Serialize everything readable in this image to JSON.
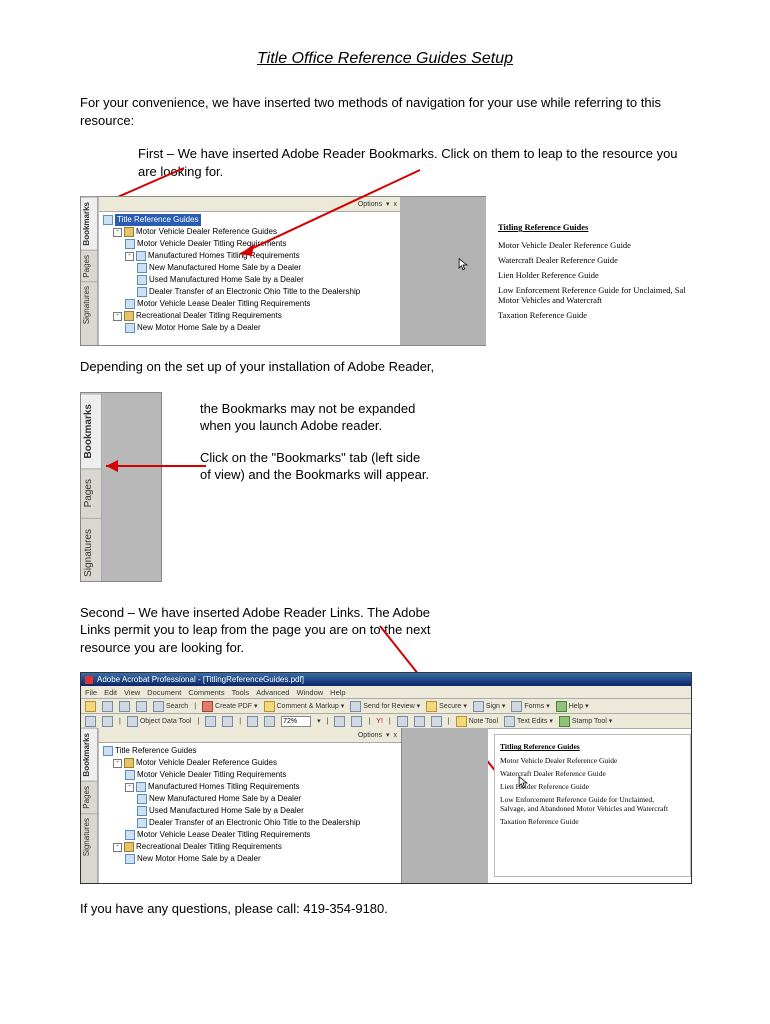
{
  "title": "Title Office Reference Guides Setup",
  "intro": "For your convenience, we have inserted two methods of navigation for your use while referring to this resource:",
  "first": "First – We have inserted Adobe Reader Bookmarks.  Click on them to leap to the resource you are looking for.",
  "depending": "Depending on the set up of your installation of Adobe Reader,",
  "second": "Second – We have inserted Adobe Reader Links. The Adobe Links permit you to leap from the page you are on to the next resource you are looking for.",
  "call": "If you have any questions, please call: 419-354-9180.",
  "shot2_a": "the Bookmarks may not be expanded when you launch Adobe reader.",
  "shot2_b": "Click on the \"Bookmarks\" tab (left side of view) and the Bookmarks will appear.",
  "tabs": {
    "bookmarks": "Bookmarks",
    "pages": "Pages",
    "signatures": "Signatures"
  },
  "toolbar1": {
    "options": "Options",
    "x": "x"
  },
  "tree": {
    "root": "Title Reference Guides",
    "n1": "Motor Vehicle Dealer Reference Guides",
    "n1a": "Motor Vehicle Dealer Titling Requirements",
    "n1b": "Manufactured Homes Titling Requirements",
    "n1b1": "New Manufactured Home Sale by a Dealer",
    "n1b2": "Used Manufactured Home Sale by a Dealer",
    "n1b3": "Dealer Transfer of an Electronic Ohio Title to the Dealership",
    "n1c": "Motor Vehicle Lease Dealer Titling Requirements",
    "n2": "Recreational Dealer Titling Requirements",
    "n2a": "New Motor Home Sale by a Dealer"
  },
  "links": {
    "hdr": "Titling Reference Guides",
    "l1": "Motor Vehicle Dealer Reference Guide",
    "l2": "Watercraft Dealer Reference Guide",
    "l3": "Lien Holder Reference Guide",
    "l4a": "Low Enforcement Reference Guide for Unclaimed, Sal",
    "l4b": "Low Enforcement Reference Guide for Unclaimed, Salvage, and Abandoned Motor Vehicles and Watercraft",
    "l4sub": "Motor Vehicles and Watercraft",
    "l5": "Taxation Reference Guide"
  },
  "app3": {
    "title": "Adobe Acrobat Professional - [TitlingReferenceGuides.pdf]",
    "menu": [
      "File",
      "Edit",
      "View",
      "Document",
      "Comments",
      "Tools",
      "Advanced",
      "Window",
      "Help"
    ],
    "tb1": {
      "search": "Search",
      "createpdf": "Create PDF",
      "comment": "Comment & Markup",
      "send": "Send for Review",
      "secure": "Secure",
      "sign": "Sign",
      "forms": "Forms",
      "help": "Help"
    },
    "tb2": {
      "objdata": "Object Data Tool",
      "zoom": "72%",
      "note": "Note Tool",
      "textedits": "Text Edits",
      "stamp": "Stamp Tool"
    },
    "tb3": {
      "options": "Options",
      "x": "x"
    }
  },
  "tree3": {
    "root": "Title Reference Guides",
    "n1": "Motor Vehicle Dealer Reference Guides",
    "n1a": "Motor Vehicle Dealer Titling Requirements",
    "n1b": "Manufactured Homes Titling Requirements",
    "n1b1": "New Manufactured Home Sale by a Dealer",
    "n1b2": "Used Manufactured Home Sale by a Dealer",
    "n1b3": "Dealer Transfer of an Electronic Ohio Title to the Dealership",
    "n1c": "Motor Vehicle Lease Dealer Titling Requirements",
    "n2": "Recreational Dealer Titling Requirements",
    "n2a": "New Motor Home Sale by a Dealer"
  }
}
